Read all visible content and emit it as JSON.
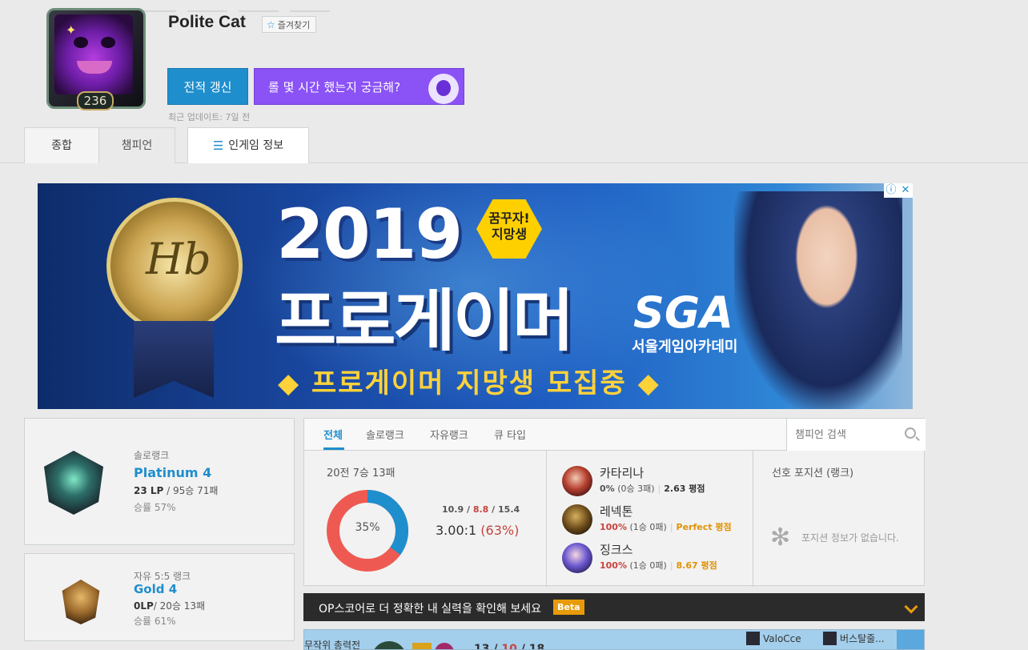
{
  "profile": {
    "name": "Polite Cat",
    "level": "236",
    "favorite_label": "즐겨찾기",
    "refresh_label": "전적 갱신",
    "promo_label": "롤 몇 시간 했는지 궁금해?",
    "last_update": "최근 업데이트: 7일 전"
  },
  "tabs": {
    "summary": "종합",
    "champion": "챔피언",
    "ingame": "인게임 정보"
  },
  "ad": {
    "year": "2019",
    "hex_badge_line1": "꿈꾸자!",
    "hex_badge_line2": "지망생",
    "headline": "프로게이머",
    "brand": "SGA",
    "brand_sub": "서울게임아카데미",
    "recruit": "◆ 프로게이머 지망생 모집중 ◆",
    "info_icon": "ⓘ",
    "close_icon": "✕"
  },
  "ranks": {
    "solo": {
      "type": "솔로랭크",
      "tier": "Platinum 4",
      "lp": "23 LP",
      "record": " / 95승 71패",
      "win_rate": "승률 57%"
    },
    "flex": {
      "type": "자유 5:5 랭크",
      "tier": "Gold 4",
      "lp": "0LP",
      "record": "/ 20승 13패",
      "win_rate": "승률 61%"
    }
  },
  "stats": {
    "tabs": [
      "전체",
      "솔로랭크",
      "자유랭크",
      "큐 타입"
    ],
    "search_placeholder": "챔피언 검색",
    "summary": "20전 7승 13패",
    "win_pct": 35,
    "win_pct_label": "35%",
    "kda_kills": "10.9",
    "kda_deaths": "8.8",
    "kda_assists": "15.4",
    "kda_ratio": "3.00:1",
    "kill_participation": "(63%)",
    "colors": {
      "win": "#1f8ecd",
      "loss": "#ee5a52"
    },
    "champions": [
      {
        "name": "카타리나",
        "win_rate": "0%",
        "record": "(0승 3패)",
        "kda": "2.63 평점"
      },
      {
        "name": "레넥톤",
        "win_rate": "100%",
        "record": "(1승 0패)",
        "kda": "Perfect 평점"
      },
      {
        "name": "징크스",
        "win_rate": "100%",
        "record": "(1승 0패)",
        "kda": "8.67 평점"
      }
    ],
    "position_title": "선호 포지션 (랭크)",
    "position_empty": "포지션 정보가 없습니다."
  },
  "op_score": {
    "text": "OP스코어로 더 정확한 내 실력을 확인해 보세요",
    "badge": "Beta"
  },
  "match_peek": {
    "mode": "무작위 총력전",
    "kills": "13",
    "deaths": "10",
    "assists": "18",
    "players": [
      "ValoCce",
      "버스탈줄..."
    ]
  }
}
